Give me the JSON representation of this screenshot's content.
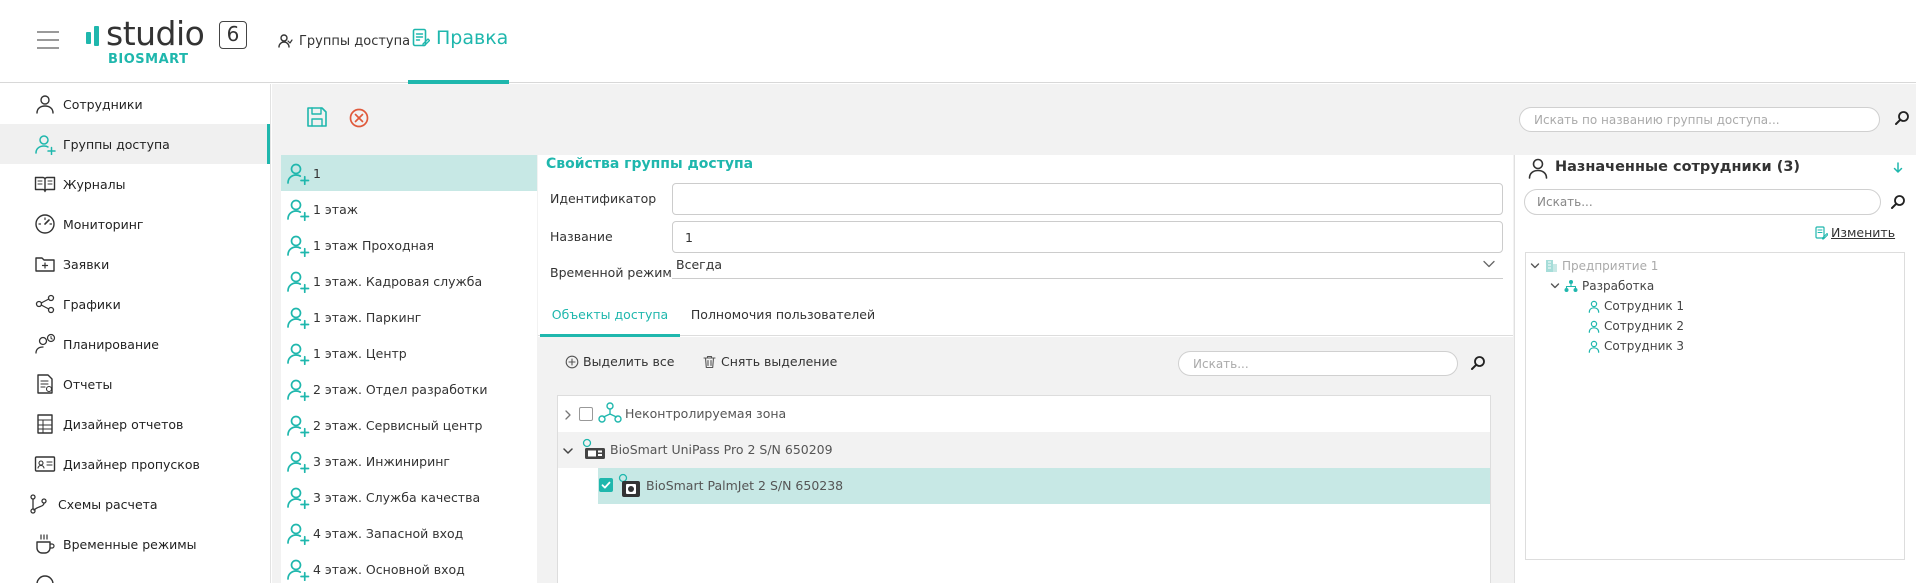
{
  "header": {
    "logo_word": "studio",
    "logo_version": "6",
    "logo_sub": "BIOSMART",
    "tab_access_groups": "Группы доступа",
    "tab_edit": "Правка"
  },
  "sidebar": {
    "items": [
      {
        "label": "Сотрудники",
        "icon": "person-icon"
      },
      {
        "label": "Группы доступа",
        "icon": "user-group-icon",
        "active": true
      },
      {
        "label": "Журналы",
        "icon": "journal-icon"
      },
      {
        "label": "Мониторинг",
        "icon": "gauge-icon"
      },
      {
        "label": "Заявки",
        "icon": "folder-icon"
      },
      {
        "label": "Графики",
        "icon": "share-icon"
      },
      {
        "label": "Планирование",
        "icon": "person-clock-icon"
      },
      {
        "label": "Отчеты",
        "icon": "report-icon"
      },
      {
        "label": "Дизайнер отчетов",
        "icon": "report-designer-icon"
      },
      {
        "label": "Дизайнер пропусков",
        "icon": "id-card-icon"
      },
      {
        "label": "Схемы расчета",
        "icon": "branch-icon"
      },
      {
        "label": "Временные режимы",
        "icon": "coffee-icon"
      }
    ]
  },
  "toolbar": {
    "group_search_placeholder": "Искать по названию группы доступа..."
  },
  "groups": [
    "1",
    "1 этаж",
    "1 этаж Проходная",
    "1 этаж. Кадровая служба",
    "1 этаж. Паркинг",
    "1 этаж. Центр",
    "2 этаж. Отдел разработки",
    "2 этаж. Сервисный центр",
    "3 этаж. Инжиниринг",
    "3 этаж. Служба качества",
    "4 этаж. Запасной вход",
    "4 этаж. Основной вход"
  ],
  "properties": {
    "title": "Свойства группы доступа",
    "id_label": "Идентификатор",
    "id_value": "",
    "name_label": "Название",
    "name_value": "1",
    "time_mode_label": "Временной режим",
    "time_mode_value": "Всегда"
  },
  "subtabs": {
    "objects": "Объекты доступа",
    "permissions": "Полномочия пользователей"
  },
  "objects": {
    "select_all": "Выделить все",
    "deselect": "Снять выделение",
    "search_placeholder": "Искать...",
    "rows": [
      {
        "label": "Неконтролируемая зона"
      },
      {
        "label": "BioSmart UniPass Pro 2 S/N 650209"
      },
      {
        "label": "BioSmart PalmJet 2 S/N 650238",
        "checked": true
      }
    ]
  },
  "employees": {
    "title": "Назначенные сотрудники (3)",
    "search_placeholder": "Искать...",
    "edit_label": "Изменить",
    "tree": {
      "enterprise": "Предприятие 1",
      "department": "Разработка",
      "people": [
        "Сотрудник 1",
        "Сотрудник 2",
        "Сотрудник 3"
      ]
    }
  },
  "colors": {
    "accent": "#1fb7ad",
    "selected_row": "#c7e8e5",
    "danger": "#e05a3c"
  }
}
